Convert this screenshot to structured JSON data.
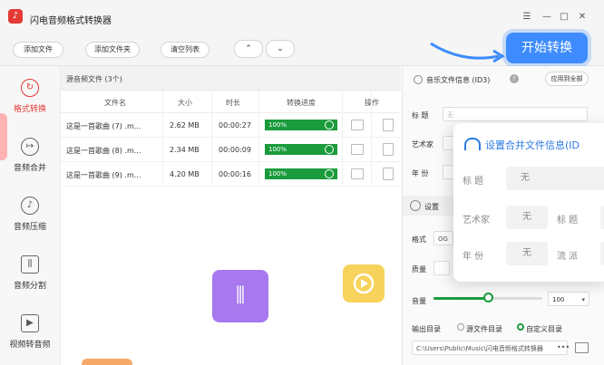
{
  "app": {
    "title": "闪电音频格式转换器"
  },
  "window_controls": [
    "☰",
    "—",
    "□",
    "✕"
  ],
  "toolbar": {
    "add_file": "添加文件",
    "add_folder": "添加文件夹",
    "clear_list": "清空列表",
    "up_arrow": "⌃",
    "down_arrow": "⌄",
    "start": "开始转换"
  },
  "sidebar": {
    "items": [
      {
        "label": "格式转换",
        "icon": "refresh-icon",
        "glyph": "↻",
        "active": true
      },
      {
        "label": "音频合并",
        "icon": "merge-icon",
        "glyph": "↦",
        "active": false
      },
      {
        "label": "音频压缩",
        "icon": "compress-icon",
        "glyph": "♪",
        "active": false
      },
      {
        "label": "音频分割",
        "icon": "split-icon",
        "glyph": "⫼",
        "active": false
      },
      {
        "label": "视频转音频",
        "icon": "video-icon",
        "glyph": "▶",
        "active": false
      }
    ]
  },
  "file_list": {
    "count_text": "源音频文件 (3个)",
    "columns": [
      "文件名",
      "大小",
      "时长",
      "转换进度",
      "操作"
    ],
    "rows": [
      {
        "name": "这是一首歌曲 (7) .m...",
        "size": "2.62 MB",
        "duration": "00:00:27",
        "progress": "100%",
        "progress_value": 100
      },
      {
        "name": "这是一首歌曲 (8) .m...",
        "size": "2.34 MB",
        "duration": "00:00:09",
        "progress": "100%",
        "progress_value": 100
      },
      {
        "name": "这是一首歌曲 (9) .m...",
        "size": "4.20 MB",
        "duration": "00:00:16",
        "progress": "100%",
        "progress_value": 100
      }
    ]
  },
  "right_panel": {
    "music_info_title": "音乐文件信息 (ID3)",
    "apply_all": "应用到全部",
    "title_label": "标  题",
    "title_placeholder": "无",
    "artist_label": "艺术家",
    "year_label": "年  份",
    "settings_label": "设置",
    "format_label": "格式",
    "format_value": "OG",
    "quality_label": "质量",
    "volume_label": "音量",
    "volume_value": "100",
    "volume_level": 0.5,
    "output_label": "输出目录",
    "output_source": "源文件目录",
    "output_custom": "自定义目录",
    "output_path": "C:\\Users\\Public\\Music\\闪电音频格式转换器"
  },
  "overlay": {
    "title": "设置合并文件信息(ID",
    "title_label": "标  题",
    "title_value": "无",
    "artist_label": "艺术家",
    "artist_value": "无",
    "title2_label": "标  题",
    "year_label": "年  份",
    "year_value": "无",
    "genre_label": "流  派"
  },
  "colors": {
    "accent": "#3d8bff",
    "active": "#e53935",
    "progress": "#1a9b3c"
  }
}
